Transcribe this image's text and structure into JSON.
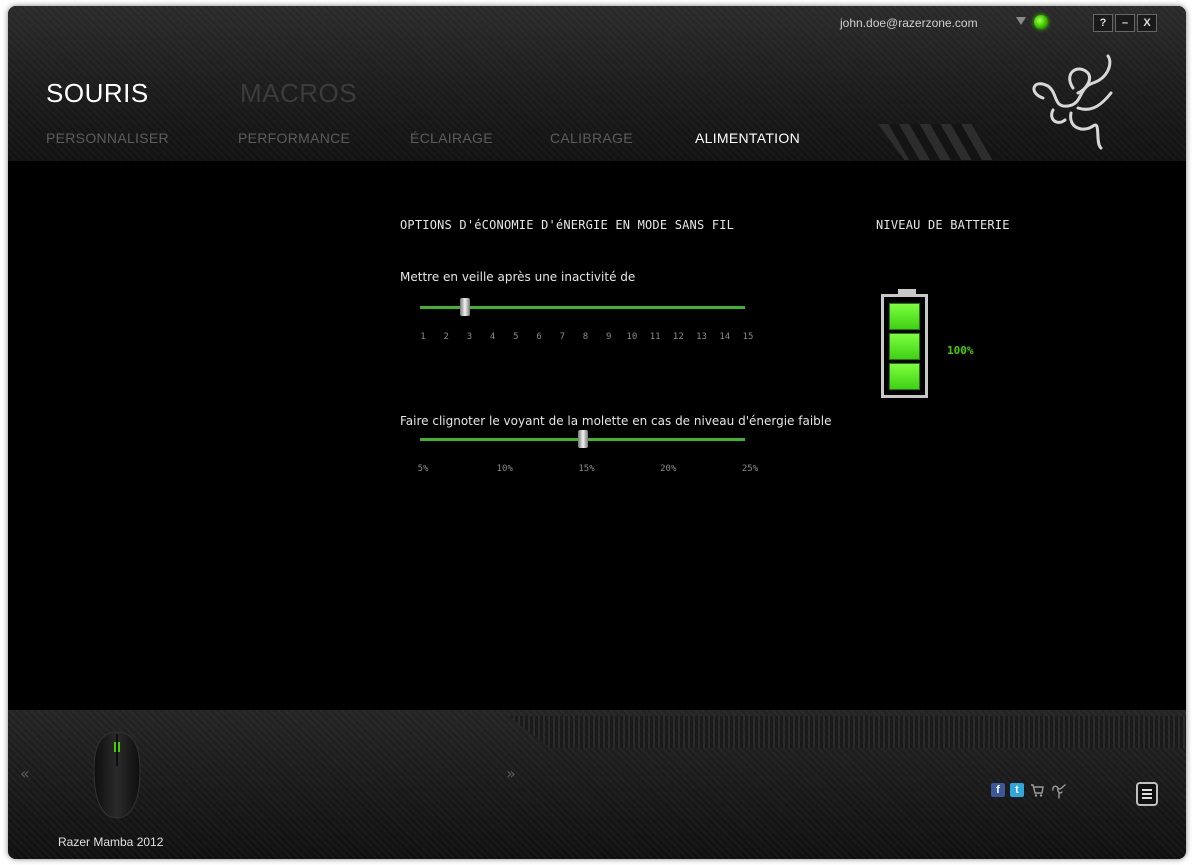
{
  "topbar": {
    "account_email": "john.doe@razerzone.com",
    "help_label": "?",
    "minimize_label": "–",
    "close_label": "X"
  },
  "nav": {
    "main_tabs": [
      {
        "label": "SOURIS",
        "active": true
      },
      {
        "label": "MACROS",
        "active": false
      }
    ],
    "sub_tabs": [
      {
        "label": "PERSONNALISER",
        "active": false
      },
      {
        "label": "PERFORMANCE",
        "active": false
      },
      {
        "label": "ÉCLAIRAGE",
        "active": false
      },
      {
        "label": "CALIBRAGE",
        "active": false
      },
      {
        "label": "ALIMENTATION",
        "active": true
      }
    ]
  },
  "power": {
    "section_title": "OPTIONS D'éCONOMIE D'éNERGIE EN MODE SANS FIL",
    "sleep": {
      "label": "Mettre en veille après une inactivité de",
      "ticks": [
        "1",
        "2",
        "3",
        "4",
        "5",
        "6",
        "7",
        "8",
        "9",
        "10",
        "11",
        "12",
        "13",
        "14",
        "15"
      ],
      "value": "3"
    },
    "low_power": {
      "label": "Faire clignoter le voyant de la molette en cas de niveau d'énergie faible",
      "ticks": [
        "5%",
        "10%",
        "15%",
        "20%",
        "25%"
      ],
      "value": "15%"
    }
  },
  "battery": {
    "title": "NIVEAU DE BATTERIE",
    "percent_label": "100%",
    "level": 1.0,
    "color": "#44d000"
  },
  "footer": {
    "device_name": "Razer Mamba 2012",
    "prev_arrow": "«",
    "next_arrow": "»",
    "icons": [
      "facebook-icon",
      "twitter-icon",
      "cart-icon",
      "razer-icon",
      "menu-icon"
    ]
  },
  "colors": {
    "accent": "#44d000",
    "slider_track": "#3fb32a",
    "background": "#000000"
  }
}
